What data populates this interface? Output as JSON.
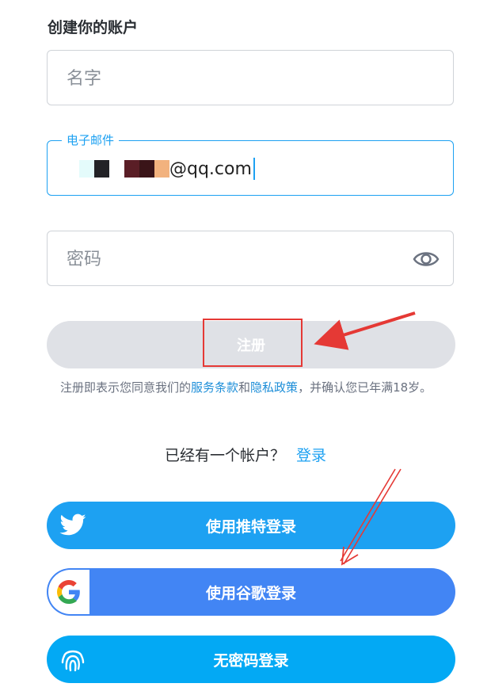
{
  "page": {
    "title": "创建你的账户"
  },
  "form": {
    "name": {
      "placeholder": "名字"
    },
    "email": {
      "label": "电子邮件",
      "value_suffix": "@qq.com"
    },
    "password": {
      "placeholder": "密码"
    },
    "signup_label": "注册"
  },
  "terms": {
    "prefix": "注册即表示您同意我们的",
    "tos_link": "服务条款",
    "and": "和",
    "privacy_link": "隐私政策",
    "suffix": "，并确认您已年满18岁。"
  },
  "login_prompt": {
    "text": "已经有一个帐户？",
    "link": "登录"
  },
  "oauth": {
    "twitter": "使用推特登录",
    "google": "使用谷歌登录",
    "passwordless": "无密码登录"
  },
  "colors": {
    "twitter": "#1da1f2",
    "google": "#4285f4",
    "passwordless": "#03a9f4",
    "annotation": "#e53935"
  }
}
